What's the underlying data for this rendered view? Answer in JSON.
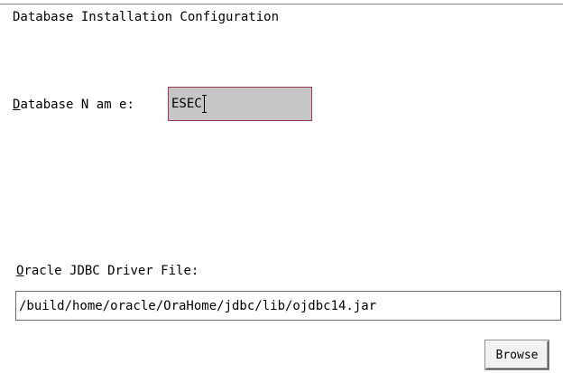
{
  "page": {
    "title": "Database Installation Configuration"
  },
  "database_name": {
    "label_mnemonic": "D",
    "label_rest": "atabase N am e:",
    "value": "ESEC"
  },
  "jdbc_driver": {
    "label_mnemonic": "O",
    "label_rest": "racle JDBC Driver File:",
    "value": "/build/home/oracle/OraHome/jdbc/lib/ojdbc14.jar"
  },
  "actions": {
    "browse_label": "Browse"
  },
  "colors": {
    "background": "#ffffff",
    "text_field_active_bg": "#c6c6c6",
    "text_field_active_border": "#9a3a52"
  }
}
